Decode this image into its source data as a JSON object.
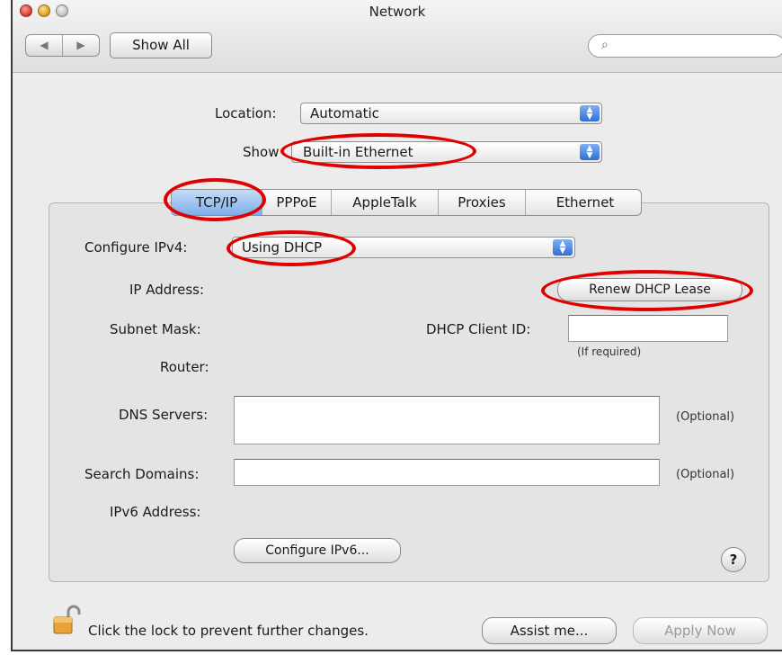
{
  "window": {
    "title": "Network"
  },
  "toolbar": {
    "back_arrow": "◀",
    "forward_arrow": "▶",
    "show_all_label": "Show All",
    "search_placeholder": "",
    "search_icon": "magnifier-icon"
  },
  "location": {
    "label": "Location:",
    "value": "Automatic"
  },
  "show": {
    "label": "Show",
    "value": "Built-in Ethernet"
  },
  "tabs": [
    {
      "label": "TCP/IP",
      "active": true
    },
    {
      "label": "PPPoE",
      "active": false
    },
    {
      "label": "AppleTalk",
      "active": false
    },
    {
      "label": "Proxies",
      "active": false
    },
    {
      "label": "Ethernet",
      "active": false
    }
  ],
  "form": {
    "configure_ipv4_label": "Configure IPv4:",
    "configure_ipv4_value": "Using DHCP",
    "ip_address_label": "IP Address:",
    "renew_button": "Renew DHCP Lease",
    "subnet_mask_label": "Subnet Mask:",
    "dhcp_client_id_label": "DHCP Client ID:",
    "dhcp_client_id_value": "",
    "dhcp_hint": "(If required)",
    "router_label": "Router:",
    "dns_label": "DNS Servers:",
    "dns_value": "",
    "dns_optional": "(Optional)",
    "search_domains_label": "Search Domains:",
    "search_domains_value": "",
    "search_optional": "(Optional)",
    "ipv6_label": "IPv6 Address:",
    "configure_ipv6_button": "Configure IPv6...",
    "help_label": "?"
  },
  "footer": {
    "lock_text": "Click the lock to prevent further changes.",
    "assist_button": "Assist me...",
    "apply_button": "Apply Now"
  },
  "colors": {
    "highlight_oval": "#e00000",
    "tab_active": "#7eaee9",
    "popup_arrows": "#2f6fd6"
  }
}
